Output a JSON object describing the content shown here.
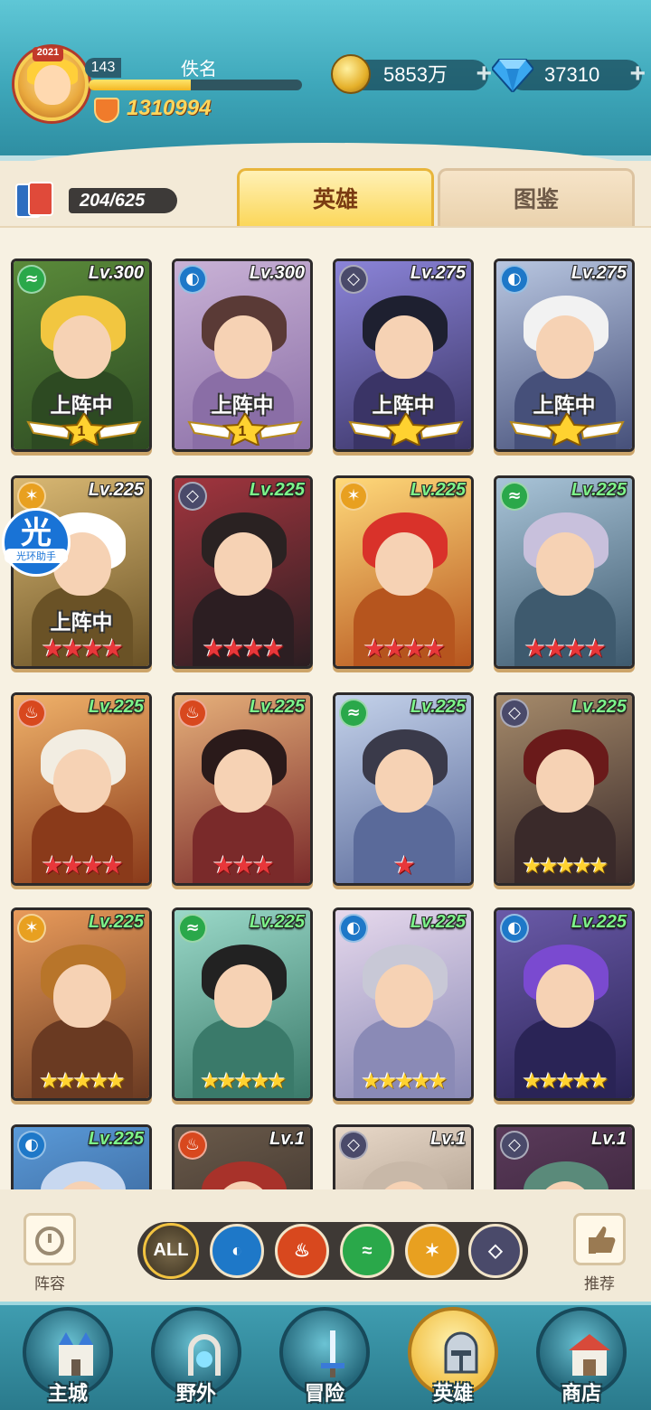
{
  "player": {
    "avatar_year": "2021",
    "level": "143",
    "name": "佚名",
    "xp_fraction": 0.48,
    "power": "1310994"
  },
  "resources": {
    "gold": "5853万",
    "gems": "37310",
    "plus": "+"
  },
  "deck": {
    "count": "204/625"
  },
  "tabs": [
    {
      "label": "英雄",
      "active": true
    },
    {
      "label": "图鉴",
      "active": false
    }
  ],
  "status_label": "上阵中",
  "helper": {
    "big": "光",
    "small": "光环助手"
  },
  "heroes": [
    {
      "level": "Lv.300",
      "elem": "nature",
      "deployed": true,
      "stars": "wing",
      "rank": "1",
      "lv_color": "#ffffff",
      "theme": [
        "#5a8a3a",
        "#2d4a22"
      ],
      "hair": "#f2c640"
    },
    {
      "level": "Lv.300",
      "elem": "water",
      "deployed": true,
      "stars": "wing",
      "rank": "1",
      "lv_color": "#ffffff",
      "theme": [
        "#c9b2d6",
        "#8a6ea6"
      ],
      "hair": "#5a3a36"
    },
    {
      "level": "Lv.275",
      "elem": "dark",
      "deployed": true,
      "stars": "wing",
      "rank": "",
      "lv_color": "#ffffff",
      "theme": [
        "#8b84d8",
        "#3a3466"
      ],
      "hair": "#1e2030"
    },
    {
      "level": "Lv.275",
      "elem": "water",
      "deployed": true,
      "stars": "wing",
      "rank": "",
      "lv_color": "#ffffff",
      "theme": [
        "#b8c6e0",
        "#46507a"
      ],
      "hair": "#f2f2f2"
    },
    {
      "level": "Lv.225",
      "elem": "light",
      "deployed": true,
      "stars": "red4",
      "lv_color": "#ffffff",
      "theme": [
        "#d9b873",
        "#6a5226"
      ],
      "hair": "#ffffff"
    },
    {
      "level": "Lv.225",
      "elem": "dark",
      "deployed": false,
      "stars": "red4",
      "lv_color": "#7df58a",
      "theme": [
        "#a2353e",
        "#2c1e22"
      ],
      "hair": "#2a2222"
    },
    {
      "level": "Lv.225",
      "elem": "light",
      "deployed": false,
      "stars": "red4",
      "lv_color": "#7df58a",
      "theme": [
        "#ffd97a",
        "#b6551e"
      ],
      "hair": "#d9322a"
    },
    {
      "level": "Lv.225",
      "elem": "nature",
      "deployed": false,
      "stars": "red4",
      "lv_color": "#7df58a",
      "theme": [
        "#a9c4d8",
        "#3e5a6e"
      ],
      "hair": "#c8c0dc"
    },
    {
      "level": "Lv.225",
      "elem": "fire",
      "deployed": false,
      "stars": "red4",
      "lv_color": "#7df58a",
      "theme": [
        "#f0b26a",
        "#8a3a1a"
      ],
      "hair": "#f2ede2"
    },
    {
      "level": "Lv.225",
      "elem": "fire",
      "deployed": false,
      "stars": "red3",
      "lv_color": "#7df58a",
      "theme": [
        "#e6b07a",
        "#7a2a2a"
      ],
      "hair": "#2a1a1a"
    },
    {
      "level": "Lv.225",
      "elem": "nature",
      "deployed": false,
      "stars": "red1",
      "lv_color": "#7df58a",
      "theme": [
        "#c4d2ea",
        "#5a6a9a"
      ],
      "hair": "#3a3a4a"
    },
    {
      "level": "Lv.225",
      "elem": "dark",
      "deployed": false,
      "stars": "gold5",
      "lv_color": "#7df58a",
      "theme": [
        "#a58a6a",
        "#3a2a2a"
      ],
      "hair": "#6a1a1a"
    },
    {
      "level": "Lv.225",
      "elem": "light",
      "deployed": false,
      "stars": "gold5",
      "lv_color": "#7df58a",
      "theme": [
        "#e89a5a",
        "#6a3a22"
      ],
      "hair": "#b8752a"
    },
    {
      "level": "Lv.225",
      "elem": "nature",
      "deployed": false,
      "stars": "gold5",
      "lv_color": "#7df58a",
      "theme": [
        "#9ad8c8",
        "#3a7a6a"
      ],
      "hair": "#222222"
    },
    {
      "level": "Lv.225",
      "elem": "water",
      "deployed": false,
      "stars": "gold5",
      "lv_color": "#7df58a",
      "theme": [
        "#e6d8ec",
        "#8a8ab6"
      ],
      "hair": "#c8c8d6"
    },
    {
      "level": "Lv.225",
      "elem": "water",
      "deployed": false,
      "stars": "gold5",
      "lv_color": "#7df58a",
      "theme": [
        "#6a5aa8",
        "#2a2456"
      ],
      "hair": "#7a4ad0"
    },
    {
      "level": "Lv.225",
      "elem": "water",
      "deployed": false,
      "stars": "",
      "lv_color": "#7df58a",
      "theme": [
        "#5a9ad8",
        "#2a4a7a"
      ],
      "hair": "#c8d8f0"
    },
    {
      "level": "Lv.1",
      "elem": "fire",
      "deployed": false,
      "stars": "",
      "lv_color": "#ffffff",
      "theme": [
        "#6a5a4a",
        "#2a2220"
      ],
      "hair": "#a8322a"
    },
    {
      "level": "Lv.1",
      "elem": "dark",
      "deployed": false,
      "stars": "",
      "lv_color": "#ffffff",
      "theme": [
        "#e8d8c8",
        "#8a7a6a"
      ],
      "hair": "#c8b8a8"
    },
    {
      "level": "Lv.1",
      "elem": "dark",
      "deployed": false,
      "stars": "",
      "lv_color": "#ffffff",
      "theme": [
        "#5a3a5a",
        "#2a1a2a"
      ],
      "hair": "#5a8a7a"
    }
  ],
  "element_colors": {
    "nature": "#2aa84a",
    "water": "#1e78c8",
    "dark": "#4a4a6a",
    "light": "#e8a020",
    "fire": "#d8481e"
  },
  "element_glyphs": {
    "nature": "≈",
    "water": "◐",
    "dark": "◇",
    "light": "✶",
    "fire": "♨"
  },
  "bottom": {
    "lineup_label": "阵容",
    "recommend_label": "推荐",
    "filter_all": "ALL"
  },
  "nav": [
    {
      "label": "主城",
      "active": false
    },
    {
      "label": "野外",
      "active": false
    },
    {
      "label": "冒险",
      "active": false
    },
    {
      "label": "英雄",
      "active": true
    },
    {
      "label": "商店",
      "active": false
    }
  ]
}
